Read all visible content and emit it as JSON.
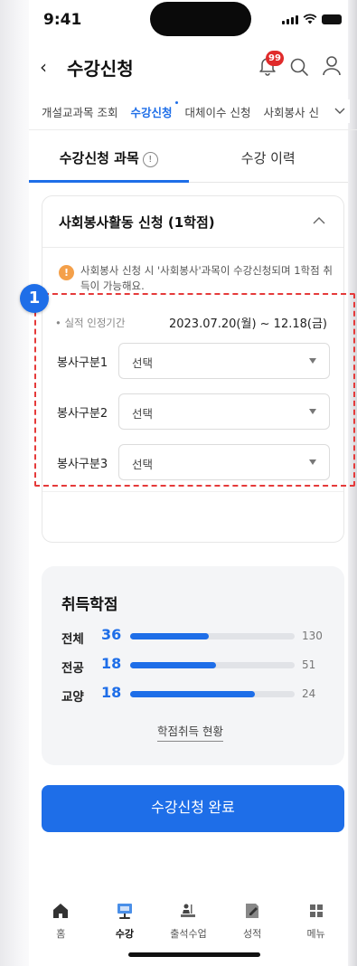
{
  "status_bar": {
    "time": "9:41"
  },
  "header": {
    "back_icon": "chevron-left-icon",
    "title": "수강신청",
    "notification_count": "99"
  },
  "menu_tabs": [
    {
      "label": "개설교과목 조회",
      "active": false
    },
    {
      "label": "수강신청",
      "active": true
    },
    {
      "label": "대체이수 신청",
      "active": false
    },
    {
      "label": "사회봉사 신",
      "active": false
    }
  ],
  "sub_tabs": [
    {
      "label": "수강신청 과목",
      "active": true
    },
    {
      "label": "수강 이력",
      "active": false
    }
  ],
  "application": {
    "title": "사회봉사활동 신청 (1학점)",
    "notice": "사회봉사 신청 시 '사회봉사'과목이 수강신청되며 1학점 취득이 가능해요.",
    "period_label": "• 실적 인정기간",
    "period_value": "2023.07.20(월) ~ 12.18(금)",
    "marker": "1",
    "selects": [
      {
        "label": "봉사구분1",
        "value": "선택"
      },
      {
        "label": "봉사구분2",
        "value": "선택"
      },
      {
        "label": "봉사구분3",
        "value": "선택"
      }
    ]
  },
  "credits": {
    "title": "취득학점",
    "rows": [
      {
        "label": "전체",
        "value": "36",
        "total": "130",
        "fraction": 0.48
      },
      {
        "label": "전공",
        "value": "18",
        "total": "51",
        "fraction": 0.52
      },
      {
        "label": "교양",
        "value": "18",
        "total": "24",
        "fraction": 0.76
      }
    ],
    "link_label": "학점취득 현황"
  },
  "submit_label": "수강신청 완료",
  "bottom_nav": [
    {
      "label": "홈",
      "icon": "home-icon",
      "active": false
    },
    {
      "label": "수강",
      "icon": "course-icon",
      "active": true
    },
    {
      "label": "출석수업",
      "icon": "attendance-icon",
      "active": false
    },
    {
      "label": "성적",
      "icon": "grades-icon",
      "active": false
    },
    {
      "label": "메뉴",
      "icon": "menu-grid-icon",
      "active": false
    }
  ],
  "colors": {
    "accent": "#1e6ee8",
    "highlight": "#e53a3a",
    "badge": "#e02b2b",
    "notice": "#f4a04a"
  }
}
